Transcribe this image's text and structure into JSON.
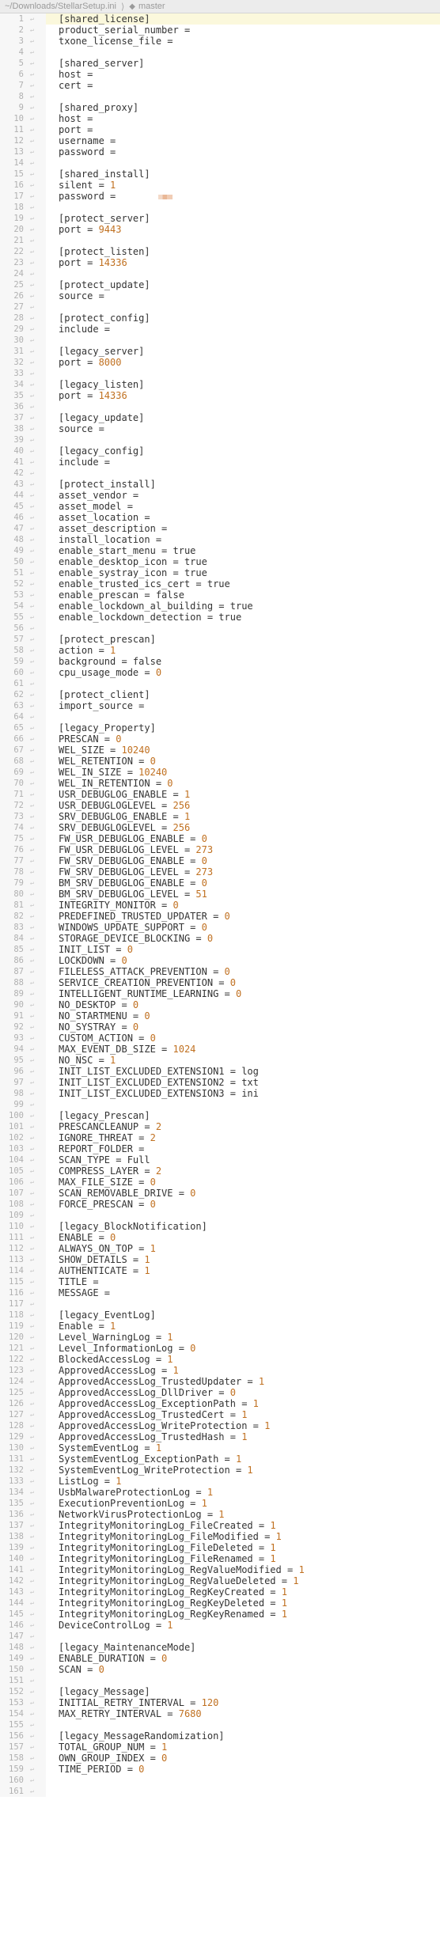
{
  "window": {
    "path": "~/Downloads/StellarSetup.ini",
    "separator": "⟩",
    "branch": "master"
  },
  "colors": {
    "number": "#c07020",
    "current_line": "#fbf8dc",
    "gutter_text": "#b0b0b0"
  },
  "lines": [
    {
      "n": "1",
      "text": "[shared_license]",
      "fold": ""
    },
    {
      "n": "2",
      "text": "product_serial_number =",
      "fold": ""
    },
    {
      "n": "3",
      "text": "txone_license_file =",
      "fold": ""
    },
    {
      "n": "4",
      "text": "",
      "fold": ""
    },
    {
      "n": "5",
      "text": "[shared_server]",
      "fold": ""
    },
    {
      "n": "6",
      "text": "host =",
      "fold": ""
    },
    {
      "n": "7",
      "text": "cert =",
      "fold": ""
    },
    {
      "n": "8",
      "text": "",
      "fold": ""
    },
    {
      "n": "9",
      "text": "[shared_proxy]",
      "fold": ""
    },
    {
      "n": "10",
      "text": "host =",
      "fold": ""
    },
    {
      "n": "11",
      "text": "port =",
      "fold": ""
    },
    {
      "n": "12",
      "text": "username =",
      "fold": ""
    },
    {
      "n": "13",
      "text": "password =",
      "fold": ""
    },
    {
      "n": "14",
      "text": "",
      "fold": ""
    },
    {
      "n": "15",
      "text": "[shared_install]",
      "fold": ""
    },
    {
      "n": "16",
      "text": "silent = ",
      "num": "1",
      "fold": ""
    },
    {
      "n": "17",
      "text": "password =",
      "redact": true,
      "fold": ""
    },
    {
      "n": "18",
      "text": "",
      "fold": ""
    },
    {
      "n": "19",
      "text": "[protect_server]",
      "fold": ""
    },
    {
      "n": "20",
      "text": "port = ",
      "num": "9443",
      "fold": ""
    },
    {
      "n": "21",
      "text": "",
      "fold": ""
    },
    {
      "n": "22",
      "text": "[protect_listen]",
      "fold": ""
    },
    {
      "n": "23",
      "text": "port = ",
      "num": "14336",
      "fold": ""
    },
    {
      "n": "24",
      "text": "",
      "fold": ""
    },
    {
      "n": "25",
      "text": "[protect_update]",
      "fold": ""
    },
    {
      "n": "26",
      "text": "source =",
      "fold": ""
    },
    {
      "n": "27",
      "text": "",
      "fold": ""
    },
    {
      "n": "28",
      "text": "[protect_config]",
      "fold": ""
    },
    {
      "n": "29",
      "text": "include =",
      "fold": ""
    },
    {
      "n": "30",
      "text": "",
      "fold": ""
    },
    {
      "n": "31",
      "text": "[legacy_server]",
      "fold": ""
    },
    {
      "n": "32",
      "text": "port = ",
      "num": "8000",
      "fold": ""
    },
    {
      "n": "33",
      "text": "",
      "fold": ""
    },
    {
      "n": "34",
      "text": "[legacy_listen]",
      "fold": ""
    },
    {
      "n": "35",
      "text": "port = ",
      "num": "14336",
      "fold": ""
    },
    {
      "n": "36",
      "text": "",
      "fold": ""
    },
    {
      "n": "37",
      "text": "[legacy_update]",
      "fold": ""
    },
    {
      "n": "38",
      "text": "source =",
      "fold": ""
    },
    {
      "n": "39",
      "text": "",
      "fold": ""
    },
    {
      "n": "40",
      "text": "[legacy_config]",
      "fold": ""
    },
    {
      "n": "41",
      "text": "include =",
      "fold": ""
    },
    {
      "n": "42",
      "text": "",
      "fold": ""
    },
    {
      "n": "43",
      "text": "[protect_install]",
      "fold": ""
    },
    {
      "n": "44",
      "text": "asset_vendor =",
      "fold": ""
    },
    {
      "n": "45",
      "text": "asset_model =",
      "fold": ""
    },
    {
      "n": "46",
      "text": "asset_location =",
      "fold": ""
    },
    {
      "n": "47",
      "text": "asset_description =",
      "fold": ""
    },
    {
      "n": "48",
      "text": "install_location =",
      "fold": ""
    },
    {
      "n": "49",
      "text": "enable_start_menu = true",
      "fold": ""
    },
    {
      "n": "50",
      "text": "enable_desktop_icon = true",
      "fold": ""
    },
    {
      "n": "51",
      "text": "enable_systray_icon = true",
      "fold": ""
    },
    {
      "n": "52",
      "text": "enable_trusted_ics_cert = true",
      "fold": ""
    },
    {
      "n": "53",
      "text": "enable_prescan = false",
      "fold": ""
    },
    {
      "n": "54",
      "text": "enable_lockdown_al_building = true",
      "fold": ""
    },
    {
      "n": "55",
      "text": "enable_lockdown_detection = true",
      "fold": ""
    },
    {
      "n": "56",
      "text": "",
      "fold": ""
    },
    {
      "n": "57",
      "text": "[protect_prescan]",
      "fold": ""
    },
    {
      "n": "58",
      "text": "action = ",
      "num": "1",
      "fold": ""
    },
    {
      "n": "59",
      "text": "background = false",
      "fold": ""
    },
    {
      "n": "60",
      "text": "cpu_usage_mode = ",
      "num": "0",
      "fold": ""
    },
    {
      "n": "61",
      "text": "",
      "fold": ""
    },
    {
      "n": "62",
      "text": "[protect_client]",
      "fold": ""
    },
    {
      "n": "63",
      "text": "import_source =",
      "fold": ""
    },
    {
      "n": "64",
      "text": "",
      "fold": ""
    },
    {
      "n": "65",
      "text": "[legacy_Property]",
      "fold": ""
    },
    {
      "n": "66",
      "text": "PRESCAN = ",
      "num": "0",
      "fold": ""
    },
    {
      "n": "67",
      "text": "WEL_SIZE = ",
      "num": "10240",
      "fold": ""
    },
    {
      "n": "68",
      "text": "WEL_RETENTION = ",
      "num": "0",
      "fold": ""
    },
    {
      "n": "69",
      "text": "WEL_IN_SIZE = ",
      "num": "10240",
      "fold": ""
    },
    {
      "n": "70",
      "text": "WEL_IN_RETENTION = ",
      "num": "0",
      "fold": ""
    },
    {
      "n": "71",
      "text": "USR_DEBUGLOG_ENABLE = ",
      "num": "1",
      "fold": ""
    },
    {
      "n": "72",
      "text": "USR_DEBUGLOGLEVEL = ",
      "num": "256",
      "fold": ""
    },
    {
      "n": "73",
      "text": "SRV_DEBUGLOG_ENABLE = ",
      "num": "1",
      "fold": ""
    },
    {
      "n": "74",
      "text": "SRV_DEBUGLOGLEVEL = ",
      "num": "256",
      "fold": ""
    },
    {
      "n": "75",
      "text": "FW_USR_DEBUGLOG_ENABLE = ",
      "num": "0",
      "fold": ""
    },
    {
      "n": "76",
      "text": "FW_USR_DEBUGLOG_LEVEL = ",
      "num": "273",
      "fold": ""
    },
    {
      "n": "77",
      "text": "FW_SRV_DEBUGLOG_ENABLE = ",
      "num": "0",
      "fold": ""
    },
    {
      "n": "78",
      "text": "FW_SRV_DEBUGLOG_LEVEL = ",
      "num": "273",
      "fold": ""
    },
    {
      "n": "79",
      "text": "BM_SRV_DEBUGLOG_ENABLE = ",
      "num": "0",
      "fold": ""
    },
    {
      "n": "80",
      "text": "BM_SRV_DEBUGLOG_LEVEL = ",
      "num": "51",
      "fold": ""
    },
    {
      "n": "81",
      "text": "INTEGRITY_MONITOR = ",
      "num": "0",
      "fold": ""
    },
    {
      "n": "82",
      "text": "PREDEFINED_TRUSTED_UPDATER = ",
      "num": "0",
      "fold": ""
    },
    {
      "n": "83",
      "text": "WINDOWS_UPDATE_SUPPORT = ",
      "num": "0",
      "fold": ""
    },
    {
      "n": "84",
      "text": "STORAGE_DEVICE_BLOCKING = ",
      "num": "0",
      "fold": ""
    },
    {
      "n": "85",
      "text": "INIT_LIST = ",
      "num": "0",
      "fold": ""
    },
    {
      "n": "86",
      "text": "LOCKDOWN = ",
      "num": "0",
      "fold": ""
    },
    {
      "n": "87",
      "text": "FILELESS_ATTACK_PREVENTION = ",
      "num": "0",
      "fold": ""
    },
    {
      "n": "88",
      "text": "SERVICE_CREATION_PREVENTION = ",
      "num": "0",
      "fold": ""
    },
    {
      "n": "89",
      "text": "INTELLIGENT_RUNTIME_LEARNING = ",
      "num": "0",
      "fold": ""
    },
    {
      "n": "90",
      "text": "NO_DESKTOP = ",
      "num": "0",
      "fold": ""
    },
    {
      "n": "91",
      "text": "NO_STARTMENU = ",
      "num": "0",
      "fold": ""
    },
    {
      "n": "92",
      "text": "NO_SYSTRAY = ",
      "num": "0",
      "fold": ""
    },
    {
      "n": "93",
      "text": "CUSTOM_ACTION = ",
      "num": "0",
      "fold": ""
    },
    {
      "n": "94",
      "text": "MAX_EVENT_DB_SIZE = ",
      "num": "1024",
      "fold": ""
    },
    {
      "n": "95",
      "text": "NO_NSC = ",
      "num": "1",
      "fold": ""
    },
    {
      "n": "96",
      "text": "INIT_LIST_EXCLUDED_EXTENSION1 = log",
      "fold": ""
    },
    {
      "n": "97",
      "text": "INIT_LIST_EXCLUDED_EXTENSION2 = txt",
      "fold": ""
    },
    {
      "n": "98",
      "text": "INIT_LIST_EXCLUDED_EXTENSION3 = ini",
      "fold": ""
    },
    {
      "n": "99",
      "text": "",
      "fold": ""
    },
    {
      "n": "100",
      "text": "[legacy_Prescan]",
      "fold": ""
    },
    {
      "n": "101",
      "text": "PRESCANCLEANUP = ",
      "num": "2",
      "fold": ""
    },
    {
      "n": "102",
      "text": "IGNORE_THREAT = ",
      "num": "2",
      "fold": ""
    },
    {
      "n": "103",
      "text": "REPORT_FOLDER =",
      "fold": ""
    },
    {
      "n": "104",
      "text": "SCAN_TYPE = Full",
      "fold": ""
    },
    {
      "n": "105",
      "text": "COMPRESS_LAYER = ",
      "num": "2",
      "fold": ""
    },
    {
      "n": "106",
      "text": "MAX_FILE_SIZE = ",
      "num": "0",
      "fold": ""
    },
    {
      "n": "107",
      "text": "SCAN_REMOVABLE_DRIVE = ",
      "num": "0",
      "fold": ""
    },
    {
      "n": "108",
      "text": "FORCE_PRESCAN = ",
      "num": "0",
      "fold": ""
    },
    {
      "n": "109",
      "text": "",
      "fold": ""
    },
    {
      "n": "110",
      "text": "[legacy_BlockNotification]",
      "fold": ""
    },
    {
      "n": "111",
      "text": "ENABLE = ",
      "num": "0",
      "fold": ""
    },
    {
      "n": "112",
      "text": "ALWAYS_ON_TOP = ",
      "num": "1",
      "fold": ""
    },
    {
      "n": "113",
      "text": "SHOW_DETAILS = ",
      "num": "1",
      "fold": ""
    },
    {
      "n": "114",
      "text": "AUTHENTICATE = ",
      "num": "1",
      "fold": ""
    },
    {
      "n": "115",
      "text": "TITLE =",
      "fold": ""
    },
    {
      "n": "116",
      "text": "MESSAGE =",
      "fold": ""
    },
    {
      "n": "117",
      "text": "",
      "fold": ""
    },
    {
      "n": "118",
      "text": "[legacy_EventLog]",
      "fold": ""
    },
    {
      "n": "119",
      "text": "Enable = ",
      "num": "1",
      "fold": ""
    },
    {
      "n": "120",
      "text": "Level_WarningLog = ",
      "num": "1",
      "fold": ""
    },
    {
      "n": "121",
      "text": "Level_InformationLog = ",
      "num": "0",
      "fold": ""
    },
    {
      "n": "122",
      "text": "BlockedAccessLog = ",
      "num": "1",
      "fold": ""
    },
    {
      "n": "123",
      "text": "ApprovedAccessLog = ",
      "num": "1",
      "fold": ""
    },
    {
      "n": "124",
      "text": "ApprovedAccessLog_TrustedUpdater = ",
      "num": "1",
      "fold": ""
    },
    {
      "n": "125",
      "text": "ApprovedAccessLog_DllDriver = ",
      "num": "0",
      "fold": ""
    },
    {
      "n": "126",
      "text": "ApprovedAccessLog_ExceptionPath = ",
      "num": "1",
      "fold": ""
    },
    {
      "n": "127",
      "text": "ApprovedAccessLog_TrustedCert = ",
      "num": "1",
      "fold": ""
    },
    {
      "n": "128",
      "text": "ApprovedAccessLog_WriteProtection = ",
      "num": "1",
      "fold": ""
    },
    {
      "n": "129",
      "text": "ApprovedAccessLog_TrustedHash = ",
      "num": "1",
      "fold": ""
    },
    {
      "n": "130",
      "text": "SystemEventLog = ",
      "num": "1",
      "fold": ""
    },
    {
      "n": "131",
      "text": "SystemEventLog_ExceptionPath = ",
      "num": "1",
      "fold": ""
    },
    {
      "n": "132",
      "text": "SystemEventLog_WriteProtection = ",
      "num": "1",
      "fold": ""
    },
    {
      "n": "133",
      "text": "ListLog = ",
      "num": "1",
      "fold": ""
    },
    {
      "n": "134",
      "text": "UsbMalwareProtectionLog = ",
      "num": "1",
      "fold": ""
    },
    {
      "n": "135",
      "text": "ExecutionPreventionLog = ",
      "num": "1",
      "fold": ""
    },
    {
      "n": "136",
      "text": "NetworkVirusProtectionLog = ",
      "num": "1",
      "fold": ""
    },
    {
      "n": "137",
      "text": "IntegrityMonitoringLog_FileCreated = ",
      "num": "1",
      "fold": ""
    },
    {
      "n": "138",
      "text": "IntegrityMonitoringLog_FileModified = ",
      "num": "1",
      "fold": ""
    },
    {
      "n": "139",
      "text": "IntegrityMonitoringLog_FileDeleted = ",
      "num": "1",
      "fold": ""
    },
    {
      "n": "140",
      "text": "IntegrityMonitoringLog_FileRenamed = ",
      "num": "1",
      "fold": ""
    },
    {
      "n": "141",
      "text": "IntegrityMonitoringLog_RegValueModified = ",
      "num": "1",
      "fold": ""
    },
    {
      "n": "142",
      "text": "IntegrityMonitoringLog_RegValueDeleted = ",
      "num": "1",
      "fold": ""
    },
    {
      "n": "143",
      "text": "IntegrityMonitoringLog_RegKeyCreated = ",
      "num": "1",
      "fold": ""
    },
    {
      "n": "144",
      "text": "IntegrityMonitoringLog_RegKeyDeleted = ",
      "num": "1",
      "fold": ""
    },
    {
      "n": "145",
      "text": "IntegrityMonitoringLog_RegKeyRenamed = ",
      "num": "1",
      "fold": ""
    },
    {
      "n": "146",
      "text": "DeviceControlLog = ",
      "num": "1",
      "fold": ""
    },
    {
      "n": "147",
      "text": "",
      "fold": ""
    },
    {
      "n": "148",
      "text": "[legacy_MaintenanceMode]",
      "fold": ""
    },
    {
      "n": "149",
      "text": "ENABLE_DURATION = ",
      "num": "0",
      "fold": ""
    },
    {
      "n": "150",
      "text": "SCAN = ",
      "num": "0",
      "fold": ""
    },
    {
      "n": "151",
      "text": "",
      "fold": ""
    },
    {
      "n": "152",
      "text": "[legacy_Message]",
      "fold": ""
    },
    {
      "n": "153",
      "text": "INITIAL_RETRY_INTERVAL = ",
      "num": "120",
      "fold": ""
    },
    {
      "n": "154",
      "text": "MAX_RETRY_INTERVAL = ",
      "num": "7680",
      "fold": ""
    },
    {
      "n": "155",
      "text": "",
      "fold": ""
    },
    {
      "n": "156",
      "text": "[legacy_MessageRandomization]",
      "fold": ""
    },
    {
      "n": "157",
      "text": "TOTAL_GROUP_NUM = ",
      "num": "1",
      "fold": ""
    },
    {
      "n": "158",
      "text": "OWN_GROUP_INDEX = ",
      "num": "0",
      "fold": ""
    },
    {
      "n": "159",
      "text": "TIME_PERIOD = ",
      "num": "0",
      "fold": ""
    },
    {
      "n": "160",
      "text": "",
      "fold": ""
    },
    {
      "n": "161",
      "text": "",
      "fold": ""
    }
  ]
}
